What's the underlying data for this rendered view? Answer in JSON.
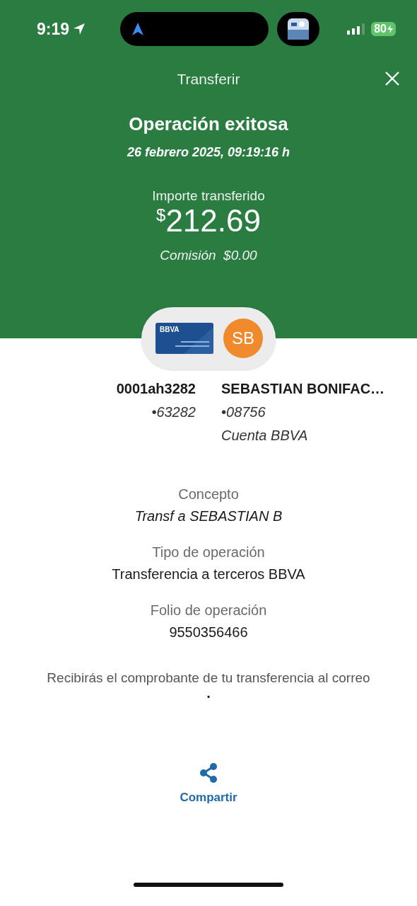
{
  "status_bar": {
    "time": "9:19",
    "battery": "80"
  },
  "header": {
    "title": "Transferir"
  },
  "result": {
    "title": "Operación exitosa",
    "datetime": "26 febrero 2025, 09:19:16 h",
    "amount_label": "Importe transferido",
    "currency": "$",
    "amount": "212.69",
    "commission": "Comisión  $0.00"
  },
  "origin": {
    "card_brand": "BBVA",
    "name": "0001ah3282",
    "account": "•63282"
  },
  "destination": {
    "initials": "SB",
    "name": "SEBASTIAN BONIFAC…",
    "account": "•08756",
    "bank": "Cuenta BBVA"
  },
  "details": [
    {
      "label": "Concepto",
      "value": "Transf a SEBASTIAN B",
      "italic": true
    },
    {
      "label": "Tipo de operación",
      "value": "Transferencia a terceros BBVA",
      "italic": false
    },
    {
      "label": "Folio de operación",
      "value": "9550356466",
      "italic": false
    }
  ],
  "notice": "Recibirás el comprobante de tu transferencia al correo",
  "notice_end": ".",
  "share_label": "Compartir"
}
